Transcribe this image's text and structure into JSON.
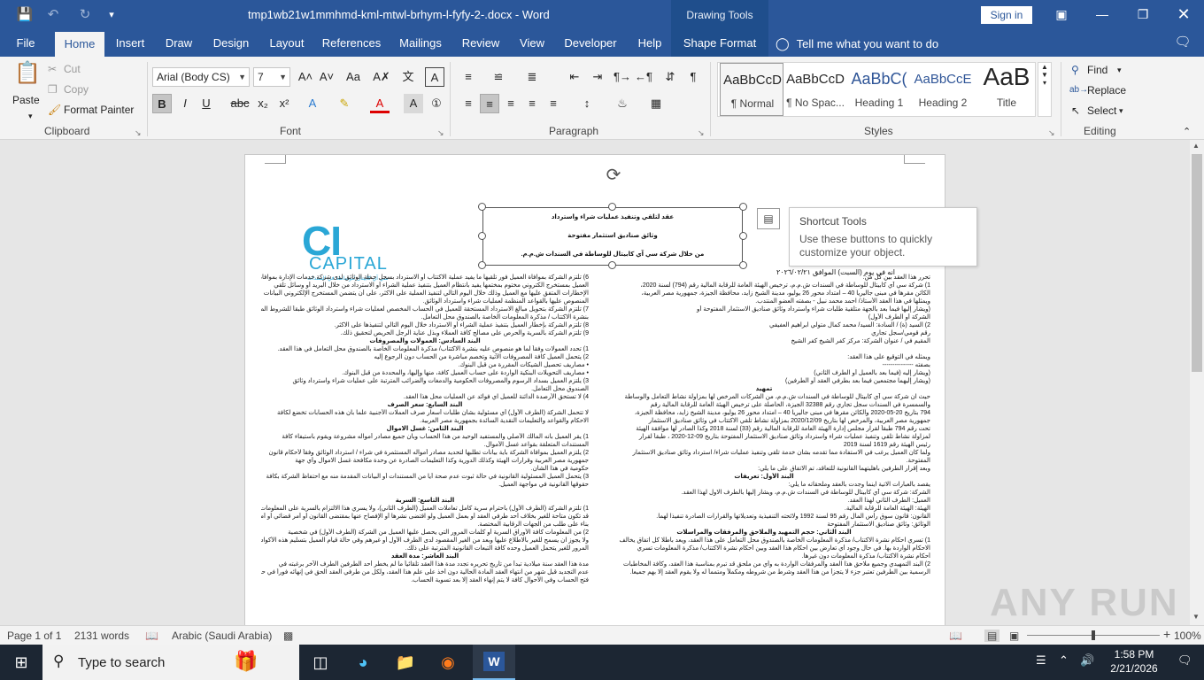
{
  "window": {
    "title": "tmp1wb21w1mmhmd-kml-mtwl-brhym-l-fyfy-2-.docx  -  Word",
    "context_tab_group": "Drawing Tools",
    "sign_in": "Sign in"
  },
  "tabs": [
    "File",
    "Home",
    "Insert",
    "Draw",
    "Design",
    "Layout",
    "References",
    "Mailings",
    "Review",
    "View",
    "Developer",
    "Help",
    "Shape Format"
  ],
  "tell_me": "Tell me what you want to do",
  "ribbon": {
    "clipboard": {
      "paste": "Paste",
      "cut": "Cut",
      "copy": "Copy",
      "format_painter": "Format Painter",
      "label": "Clipboard"
    },
    "font": {
      "name": "Arial (Body CS)",
      "size": "7",
      "label": "Font"
    },
    "paragraph": {
      "label": "Paragraph"
    },
    "styles": {
      "label": "Styles",
      "items": [
        {
          "preview": "AaBbCcD",
          "name": "¶ Normal"
        },
        {
          "preview": "AaBbCcD",
          "name": "¶ No Spac..."
        },
        {
          "preview": "AaBbC(",
          "name": "Heading 1"
        },
        {
          "preview": "AaBbCcE",
          "name": "Heading 2"
        },
        {
          "preview": "AaB",
          "name": "Title"
        }
      ]
    },
    "editing": {
      "find": "Find",
      "replace": "Replace",
      "select": "Select",
      "label": "Editing"
    }
  },
  "document": {
    "textbox_lines": [
      "عقد لتلقي وتنفيذ عمليات شراء واسترداد",
      "وثائق صناديق استثمار مفتوحة",
      "من خلال شركة سي آي كابيتال للوساطة في السندات ش.م.م."
    ],
    "logo": {
      "ci": "CI",
      "capital": "CAPITAL",
      "sub": "سي آي كابيتال للوساطة في السندات"
    },
    "date_line": "انه في يوم  (السبت)  الموافق      ٢٠٢٦/٠٢/٢١",
    "right_column": [
      "تحرر هذا العقد بين كل من:",
      "1)   شركة سي آي كابيتال للوساطة في السندات ش.م.م، ترخيص الهيئة العامة للرقابة المالية رقم (794) لسنة 2020،",
      "الكائن مقرها في مبنى جاليريا 40 – امتداد محور 26 يوليو، مدينة الشيخ زايد، محافظة الجيزة، جمهورية مصر العربية،",
      "ويمثلها في هذا العقد الأستاذ/ احمد محمد نبيل - بصفته العضو المنتدب.",
      "(ويشار إليها فيما بعد بالجهة متلقية طلبات شراء واسترداد وثائق صناديق الاستثمار المفتوحة أو",
      "الشركة أو الطرف الأول)",
      "2)   السيد (ة) / السادة: السيد/ محمد كمال متولي ابراهيم العفيفي",
      "رقم قومي/سجل تجاري",
      "المقيم في / عنوان الشركة: مركز كفر الشيخ كفر الشيخ",
      "",
      "ويمثله في التوقيع على هذا العقد:",
      "بصفته ---------------",
      "(ويشار إليه (فيما بعد بالعميل أو الطرف الثاني)",
      "(ويشار إليهما مجتمعين فيما بعد بطرفي العقد أو الطرفين)",
      "تمهيد",
      "حيث ان شركة سي آي كابيتال للوساطة في السندات ش.م.م، من الشركات المرخص لها بمزاولة نشاط التعامل والوساطة",
      "والسمسرة في السندات سجل تجاري رقم 32388 الجيزة، الحاصلة على ترخيص الهيئة العامة للرقابة المالية رقم",
      "794 بتاريخ 20-05-2020 والكائن مقرها في مبنى جاليريا 40 – امتداد محور 26 يوليو، مدينة الشيخ زايد، محافظة الجيزة،",
      "جمهورية مصر العربية، والمرخص لها بتاريخ 2020/12/09 بمزاولة نشاط تلقي الاكتتاب في وثائق صناديق الاستثمار",
      "تحت رقم 794 طبقاً لقرار مجلس إدارة الهيئة العامة للرقابة المالية رقم (33) لسنة 2018 وكذا الصادر لها موافقة الهيئة",
      "لمزاولة نشاط تلقي وتنفيذ عمليات شراء واسترداد وثائق صناديق الاستثمار المفتوحة بتاريخ 09-12-2020 ، طبقاً لقرار",
      "رئيس الهيئة رقم 1619 لسنة 2019",
      "ولما كان العميل يرغب في الاستفادة مما تقدمه بشأن خدمة تلقي وتنفيذ عمليات شراء/ استرداد وثائق صناديق الاستثمار",
      "المفتوحة.",
      "وبعد إقرار الطرفين بأهليتهما القانونية للتعاقد، تم الاتفاق على ما يلي:",
      "البند الأول: تعريفات",
      "يقصد بالعبارات الاتية اينما وجدت بالعقد وملحقاته ما يلي:",
      "الشركة: شركة سي آي كابيتال للوساطة في السندات ش.م.م، ويشار إليها بالطرف الاول لهذا العقد.",
      "العميل: الطرف الثاني لهذا العقد.",
      "الهيئة: الهيئة العامة للرقابة المالية.",
      "القانون: قانون سوق رأس المال رقم 95 لسنة 1992 ولائحته التنفيذية وتعديلاتها والقرارات الصادرة تنفيذا لهما.",
      "الوثائق: وثائق صناديق الاستثمار المفتوحة",
      "البند الثاني: حجم التمهيد والملاحق والمرفقات والمراسلات",
      "1)   تسري احكام نشرة الاكتتاب/ مذكرة المعلومات الخاصة بالصندوق محل التعامل على هذا العقد، ويعد باطلا كل اتفاق يخالف",
      "الاحكام الواردة بها. في حال وجود أي تعارض بين احكام هذا العقد وبين أحكام نشرة الاكتتاب/ مذكرة المعلومات تسري",
      "أحكام نشرة الاكتتاب/ مذكرة المعلومات دون غيرها.",
      "2)   البند التمهيدي وجميع ملاحق هذا العقد والمرفقات الواردة به وأي من ملحق قد تبرم بمناسبة هذا العقد، وكافة المخاطبات",
      "الرسمية بين الطرفين تعتبر جزء لا يتجزأ من هذا العقد وشرط من شروطه ومكملاً ومتمماً له ولا يقوم العقد إلا بهم جميعا."
    ],
    "left_column": [
      "6)   تلتزم الشركة بموافاة العميل فور تلقيها ما يفيد عملية الاكتتاب أو الاسترداد بسجل حملة الوثائق لدى شركة خدمات الإدارة بموافاة",
      "العميل بمستخرج الكتروني مختوم بمختمها يفيد بانتظام العميل بتنفيذ عملية الشراء أو الاسترداد من خلال البريد أو وسائل تلقي",
      "الإخطارات المتفق عليها مع العميل وذلك خلال اليوم التالي لتنفيذ العملية على الاكثر، على أن يتضمن المستخرج الإلكتروني البيانات",
      "المنصوص عليها بالقواعد المنظمة لعمليات شراء واسترداد الوثائق.",
      "7)   تلتزم الشركة بتحويل مبالغ الاسترداد المستحقة للعميل في الحساب المخصص لعمليات شراء واسترداد الوثائق طبقاً للشروط المحددة",
      "بنشرة الاكتتاب / مذكرة المعلومات الخاصة بالصندوق محل التعامل.",
      "8)   تلتزم الشركة بإخطار العميل بتنفيذ عملية الشراء أو الاسترداد خلال اليوم التالي لتنفيذها على الاكثر.",
      "9)   تلتزم الشركة بالسرية والحرص على مصالح كافة العملاء وبذل عناية الرجل الحريص لتحقيق ذلك.",
      "البند السادس: العمولات والمصروفات",
      "1)   تحدد العمولات وفقاً لما هو منصوص عليه بنشرة الاكتتاب/ مذكرة المعلومات الخاصة بالصندوق محل التعامل في هذا العقد.",
      "2)   يتحمل العميل كافة المصروفات الآتية وتخصم مباشرة من الحساب دون الرجوع إليه",
      "•   مصاريف تحصيل الشيكات المقررة من قبل البنوك.",
      "•   مصاريف التحويلات البنكية الواردة على حساب العميل كافة، منها وإليها، والمحددة من قبل البنوك.",
      "3)   يلتزم العميل بسداد الرسوم والمصروفات الحكومية والدمغات والضرائب المترتبة على عمليات شراء واسترداد وثائق",
      "الصندوق محل التعامل.",
      "4)   لا تستحق الأرصدة الدائنة للعميل اي فوائد عن العمليات محل هذا العقد.",
      "البند السابع: سعر الصرف",
      "لا تتحمل الشركة (الطرف الأول) أي مسئولية بشأن طلبات أسعار صرف العملات الأجنبية علما بأن هذه الحسابات تخضع لكافة",
      "الاحكام والقواعد والتعليمات النقدية السائدة بجمهورية مصر العربية.",
      "البند الثامن: غسل الاموال",
      "1)   يقر العميل بأنه المالك الأصلي والمستفيد الوحيد من هذا الحساب وبأن جميع مصادر أمواله مشروعة ويقوم باستيفاء كافة",
      "المستندات المتعلقة بقواعد غسل الأموال.",
      "2)   يلتزم العميل بموافاة الشركة بأية بيانات تطلبها لتحديد مصادر أمواله المستثمرة في شراء / استرداد الوثائق وفقاً لأحكام قانون",
      "جمهورية مصر العربية وقرارات الهيئة وكذلك الدورية وكذا التعليمات الصادرة عن وحدة مكافحة غسل الاموال وأي جهة",
      "حكومية في هذا الشأن.",
      "3)   يتحمل العميل المسئولية القانونية في حالة ثبوت عدم صحة أيا من المستندات أو البيانات المقدمة منه مع احتفاظ الشركة بكافة",
      "حقوقها القانونية في مواجهة العميل.",
      "",
      "البند التاسع: السرية",
      "1)   تلتزم الشركة (الطرف الأول) باحترام سرية كامل تعاملات العميل (الطرف الثاني)، ولا يسري هذا الالتزام بالسرية على المعلومات التي",
      "قد تكون متاحة للغير بخلاف أحد طرفي العقد أو بعمل العميل ولو اقتضى نشرها أو الإفصاح عنها بمقتضى القانون أو أمر قضائي أو أمر حكومي أو",
      "بناء على طلب من الجهات الرقابية المختصة.",
      "2)   من المعلومات كافة الأوراق السرية أو كلمات المرور التي يحصل عليها العميل من الشركة (الطرف الأول) في شخصية",
      "ولا يجوز ان يسمح للغير بالاطلاع عليها وبعد من الغير المقصود لدى الطرف الأول أو غيرهم وفي حالة قيام العميل بتسليم هذه الأكواد أو كلمات",
      "المرور للغير يتحمل العميل وحده كافة التبعات القانونية المترتبة على ذلك.",
      "البند العاشر: مدة العقد",
      "مدة هذا العقد سنة ميلادية تبدأ من تاريخ تحريره تجدد مدة هذا العقد تلقائياً ما لم يخطر أحد الطرفين الطرف الآخر برغبته في",
      "عدم التجديد قبل شهر من انتهاء العقد المادة الحالية دون أخذ على علم هذا العقد، ولكل من طرفي العقد الحق في إنهائه فوراً في حالة",
      "فتح الحساب وفي الأحوال كافة لا يتم إنهاء العقد إلا بعد تسوية الحساب."
    ]
  },
  "tooltip": {
    "title": "Shortcut Tools",
    "body": "Use these buttons to quickly customize your object."
  },
  "statusbar": {
    "page": "Page 1 of 1",
    "words": "2131 words",
    "language": "Arabic (Saudi Arabia)",
    "zoom": "100%",
    "zoom_level": 100
  },
  "taskbar": {
    "search_placeholder": "Type to search",
    "time": "1:58 PM",
    "date": "2/21/2026"
  },
  "watermark": "ANY RUN"
}
